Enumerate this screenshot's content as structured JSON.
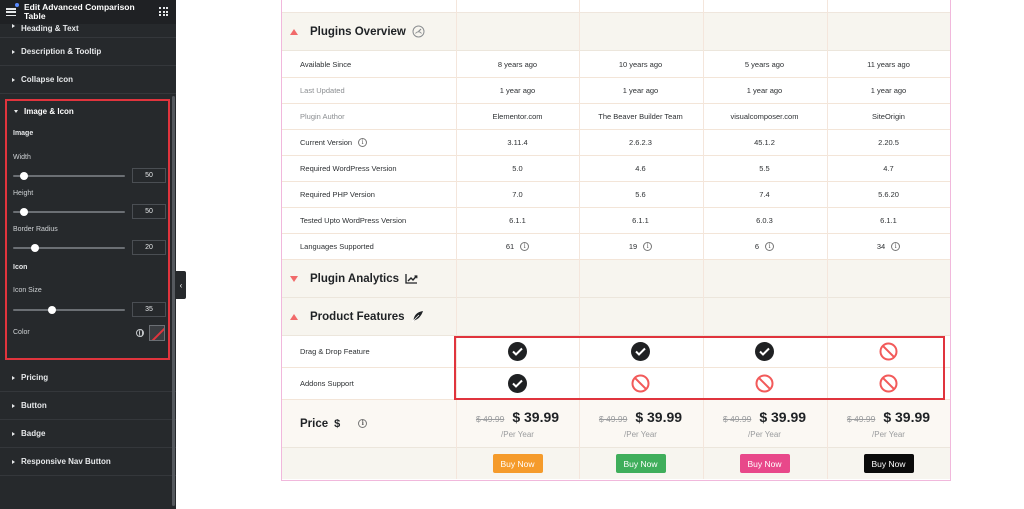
{
  "sidebar": {
    "title": "Edit Advanced Comparison Table",
    "top_sections": [
      "Heading & Text",
      "Description & Tooltip",
      "Collapse Icon"
    ],
    "panel": {
      "title": "Image & Icon",
      "image_heading": "Image",
      "width_label": "Width",
      "width_value": "50",
      "width_level": 0.1,
      "height_label": "Height",
      "height_value": "50",
      "height_level": 0.1,
      "radius_label": "Border Radius",
      "radius_value": "20",
      "radius_level": 0.2,
      "icon_heading": "Icon",
      "icon_size_label": "Icon Size",
      "icon_size_value": "35",
      "icon_size_level": 0.35,
      "color_label": "Color"
    },
    "lower_sections": [
      "Pricing",
      "Button",
      "Badge",
      "Responsive Nav Button"
    ]
  },
  "table": {
    "groups": {
      "overview": "Plugins Overview",
      "analytics": "Plugin Analytics",
      "features": "Product Features"
    },
    "overview_rows": [
      {
        "label": "Available Since",
        "muted": false,
        "info": false,
        "values": [
          "8 years ago",
          "10 years ago",
          "5 years ago",
          "11 years ago"
        ],
        "value_info": false
      },
      {
        "label": "Last Updated",
        "muted": true,
        "info": false,
        "values": [
          "1 year ago",
          "1 year ago",
          "1 year ago",
          "1 year ago"
        ],
        "value_info": false
      },
      {
        "label": "Plugin Author",
        "muted": true,
        "info": false,
        "values": [
          "Elementor.com",
          "The Beaver Builder Team",
          "visualcomposer.com",
          "SiteOrigin"
        ],
        "value_info": false
      },
      {
        "label": "Current Version",
        "muted": false,
        "info": true,
        "values": [
          "3.11.4",
          "2.6.2.3",
          "45.1.2",
          "2.20.5"
        ],
        "value_info": false
      },
      {
        "label": "Required WordPress Version",
        "muted": false,
        "info": false,
        "values": [
          "5.0",
          "4.6",
          "5.5",
          "4.7"
        ],
        "value_info": false
      },
      {
        "label": "Required PHP Version",
        "muted": false,
        "info": false,
        "values": [
          "7.0",
          "5.6",
          "7.4",
          "5.6.20"
        ],
        "value_info": false
      },
      {
        "label": "Tested Upto WordPress Version",
        "muted": false,
        "info": false,
        "values": [
          "6.1.1",
          "6.1.1",
          "6.0.3",
          "6.1.1"
        ],
        "value_info": false
      },
      {
        "label": "Languages Supported",
        "muted": false,
        "info": false,
        "values": [
          "61",
          "19",
          "6",
          "34"
        ],
        "value_info": true
      }
    ],
    "feature_rows": [
      {
        "label": "Drag & Drop Feature",
        "values": [
          "check",
          "check",
          "check",
          "no"
        ]
      },
      {
        "label": "Addons Support",
        "values": [
          "check",
          "no",
          "no",
          "no"
        ]
      }
    ],
    "price": {
      "label": "Price",
      "symbol": "$",
      "old": "$ 49.99",
      "new": "$ 39.99",
      "period": "/Per Year"
    },
    "buttons": [
      {
        "label": "Buy Now",
        "color": "#f59b2b"
      },
      {
        "label": "Buy Now",
        "color": "#3fae5b"
      },
      {
        "label": "Buy Now",
        "color": "#e8488a"
      },
      {
        "label": "Buy Now",
        "color": "#0b0b0b"
      }
    ],
    "colors": {
      "accent": "#f16a6a",
      "highlight": "#e0343d"
    }
  }
}
